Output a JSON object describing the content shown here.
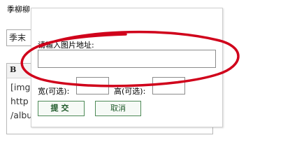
{
  "background": {
    "title": "季柳柳",
    "field_value": "季末",
    "editor_toolbar_bold": "B",
    "editor_lines": [
      "[img",
      "http",
      "/albu"
    ]
  },
  "dialog": {
    "url_label": "请输入图片地址:",
    "url_value": "",
    "width_label": "宽(可选):",
    "height_label": "高(可选):",
    "width_value": "",
    "height_value": "",
    "submit_label": "提交",
    "cancel_label": "取消"
  },
  "annotation": {
    "color": "#d0021b",
    "shape": "ellipse"
  }
}
